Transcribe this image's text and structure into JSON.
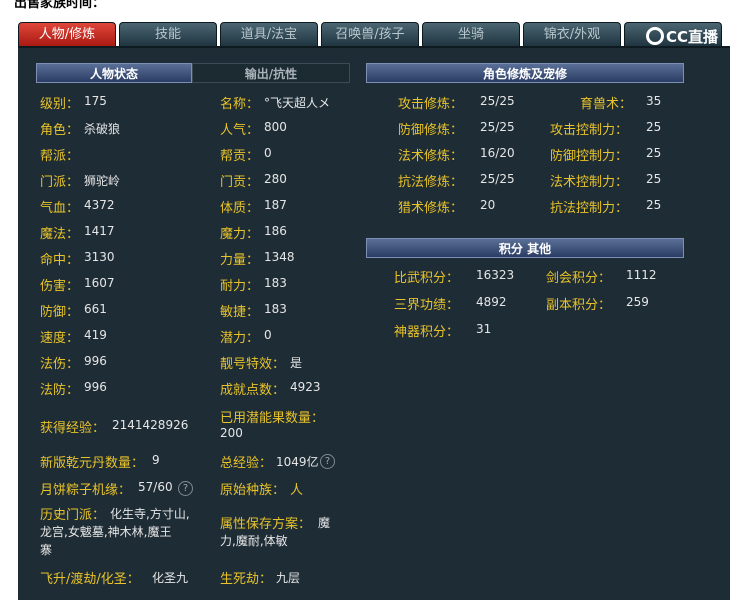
{
  "top_text": "出售家族时间：",
  "tabs": [
    "人物/修炼",
    "技能",
    "道具/法宝",
    "召唤兽/孩子",
    "坐骑",
    "锦衣/外观"
  ],
  "logo_text": "CC直播",
  "left": {
    "header_active": "人物状态",
    "header_inactive": "输出/抗性",
    "col1": [
      {
        "label": "级别：",
        "value": "175"
      },
      {
        "label": "角色：",
        "value": "杀破狼"
      },
      {
        "label": "帮派：",
        "value": ""
      },
      {
        "label": "门派：",
        "value": "狮驼岭"
      },
      {
        "label": "气血：",
        "value": "4372"
      },
      {
        "label": "魔法：",
        "value": "1417"
      },
      {
        "label": "命中：",
        "value": "3130"
      },
      {
        "label": "伤害：",
        "value": "1607"
      },
      {
        "label": "防御：",
        "value": "661"
      },
      {
        "label": "速度：",
        "value": "419"
      },
      {
        "label": "法伤：",
        "value": "996"
      },
      {
        "label": "法防：",
        "value": "996"
      }
    ],
    "col2": [
      {
        "label": "名称：",
        "value": "°飞天超人メ"
      },
      {
        "label": "人气：",
        "value": "800"
      },
      {
        "label": "帮贡：",
        "value": "0"
      },
      {
        "label": "门贡：",
        "value": "280"
      },
      {
        "label": "体质：",
        "value": "187"
      },
      {
        "label": "魔力：",
        "value": "186"
      },
      {
        "label": "力量：",
        "value": "1348"
      },
      {
        "label": "耐力：",
        "value": "183"
      },
      {
        "label": "敏捷：",
        "value": "183"
      },
      {
        "label": "潜力：",
        "value": "0"
      },
      {
        "label": "靓号特效：",
        "value": "是"
      },
      {
        "label": "成就点数：",
        "value": "4923"
      }
    ],
    "exp_label": "获得经验：",
    "exp_value": "2141428926",
    "used_label": "已用潜能果数量：",
    "used_value": "200",
    "qianyuan_label": "新版乾元丹数量：",
    "qianyuan_value": "9",
    "total_exp_label": "总经验：",
    "total_exp_value": "1049亿",
    "moon_label": "月饼粽子机缘：",
    "moon_value": "57/60",
    "race_label": "原始种族：",
    "race_value": "人",
    "history_label": "历史门派：",
    "history_value_1": "化生寺,方寸山,",
    "history_value_2": "龙宫,女魃墓,神木林,魔王",
    "history_value_3": "寨",
    "attr_label": "属性保存方案：",
    "attr_value_1": "魔",
    "attr_value_2": "力,魔耐,体敏",
    "feisheng_label": "飞升/渡劫/化圣：",
    "feisheng_value": "化圣九",
    "shengsi_label": "生死劫：",
    "shengsi_value": "九层"
  },
  "right": {
    "header_cultivation": "角色修炼及宠修",
    "cult_left": [
      {
        "label": "攻击修炼：",
        "value": "25/25"
      },
      {
        "label": "防御修炼：",
        "value": "25/25"
      },
      {
        "label": "法术修炼：",
        "value": "16/20"
      },
      {
        "label": "抗法修炼：",
        "value": "25/25"
      },
      {
        "label": "猎术修炼：",
        "value": "20"
      }
    ],
    "cult_right": [
      {
        "label": "育兽术：",
        "value": "35"
      },
      {
        "label": "攻击控制力：",
        "value": "25"
      },
      {
        "label": "防御控制力：",
        "value": "25"
      },
      {
        "label": "法术控制力：",
        "value": "25"
      },
      {
        "label": "抗法控制力：",
        "value": "25"
      }
    ],
    "header_points": "积分 其他",
    "points_left": [
      {
        "label": "比武积分：",
        "value": "16323"
      },
      {
        "label": "三界功绩：",
        "value": "4892"
      },
      {
        "label": "神器积分：",
        "value": "31"
      }
    ],
    "points_right": [
      {
        "label": "剑会积分：",
        "value": "1112"
      },
      {
        "label": "副本积分：",
        "value": "259"
      }
    ]
  }
}
